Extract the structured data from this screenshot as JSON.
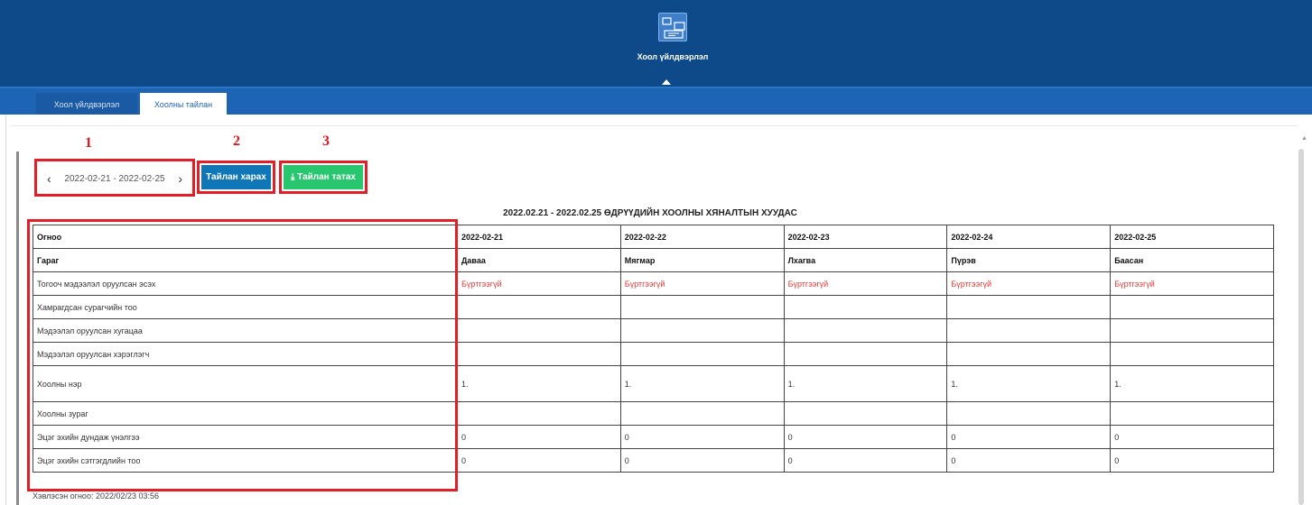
{
  "app": {
    "tile_label": "Хоол үйлдвэрлэл"
  },
  "tabs": [
    {
      "label": "Хоол үйлдвэрлэл",
      "active": false
    },
    {
      "label": "Хоолны тайлан",
      "active": true
    }
  ],
  "markers": [
    "1",
    "2",
    "3"
  ],
  "toolbar": {
    "date_range": "2022-02-21 - 2022-02-25",
    "view_label": "Тайлан харах",
    "download_label": "Тайлан татах",
    "view_color": "#0f77b8",
    "download_color": "#28c76f"
  },
  "report": {
    "title": "2022.02.21 - 2022.02.25 ӨДРҮҮДИЙН ХООЛНЫ ХЯНАЛТЫН ХУУДАС",
    "rows": [
      {
        "label": "Огноо",
        "bold": true,
        "cells": [
          "2022-02-21",
          "2022-02-22",
          "2022-02-23",
          "2022-02-24",
          "2022-02-25"
        ]
      },
      {
        "label": "Гараг",
        "bold": true,
        "cells": [
          "Даваа",
          "Мягмар",
          "Лхагва",
          "Пүрэв",
          "Баасан"
        ]
      },
      {
        "label": "Тогооч мэдээлэл оруулсан эсэх",
        "status": true,
        "cells": [
          "Бүртгээгүй",
          "Бүртгээгүй",
          "Бүртгээгүй",
          "Бүртгээгүй",
          "Бүртгээгүй"
        ]
      },
      {
        "label": "Хамрагдсан сурагчийн тоо",
        "cells": [
          "",
          "",
          "",
          "",
          ""
        ]
      },
      {
        "label": "Мэдээлэл оруулсан хугацаа",
        "cells": [
          "",
          "",
          "",
          "",
          ""
        ]
      },
      {
        "label": "Мэдээлэл оруулсан хэрэглэгч",
        "cells": [
          "",
          "",
          "",
          "",
          ""
        ]
      },
      {
        "label": "Хоолны нэр",
        "tall": true,
        "cells": [
          "1.",
          "1.",
          "1.",
          "1.",
          "1."
        ]
      },
      {
        "label": "Хоолны зураг",
        "cells": [
          "",
          "",
          "",
          "",
          ""
        ]
      },
      {
        "label": "Эцэг эхийн дундаж үнэлгээ",
        "cells": [
          "0",
          "0",
          "0",
          "0",
          "0"
        ]
      },
      {
        "label": "Эцэг эхийн сэтгэгдлийн тоо",
        "cells": [
          "0",
          "0",
          "0",
          "0",
          "0"
        ]
      }
    ]
  },
  "footer": {
    "printed": "Хэвлэсэн огноо: 2022/02/23 03:56"
  }
}
